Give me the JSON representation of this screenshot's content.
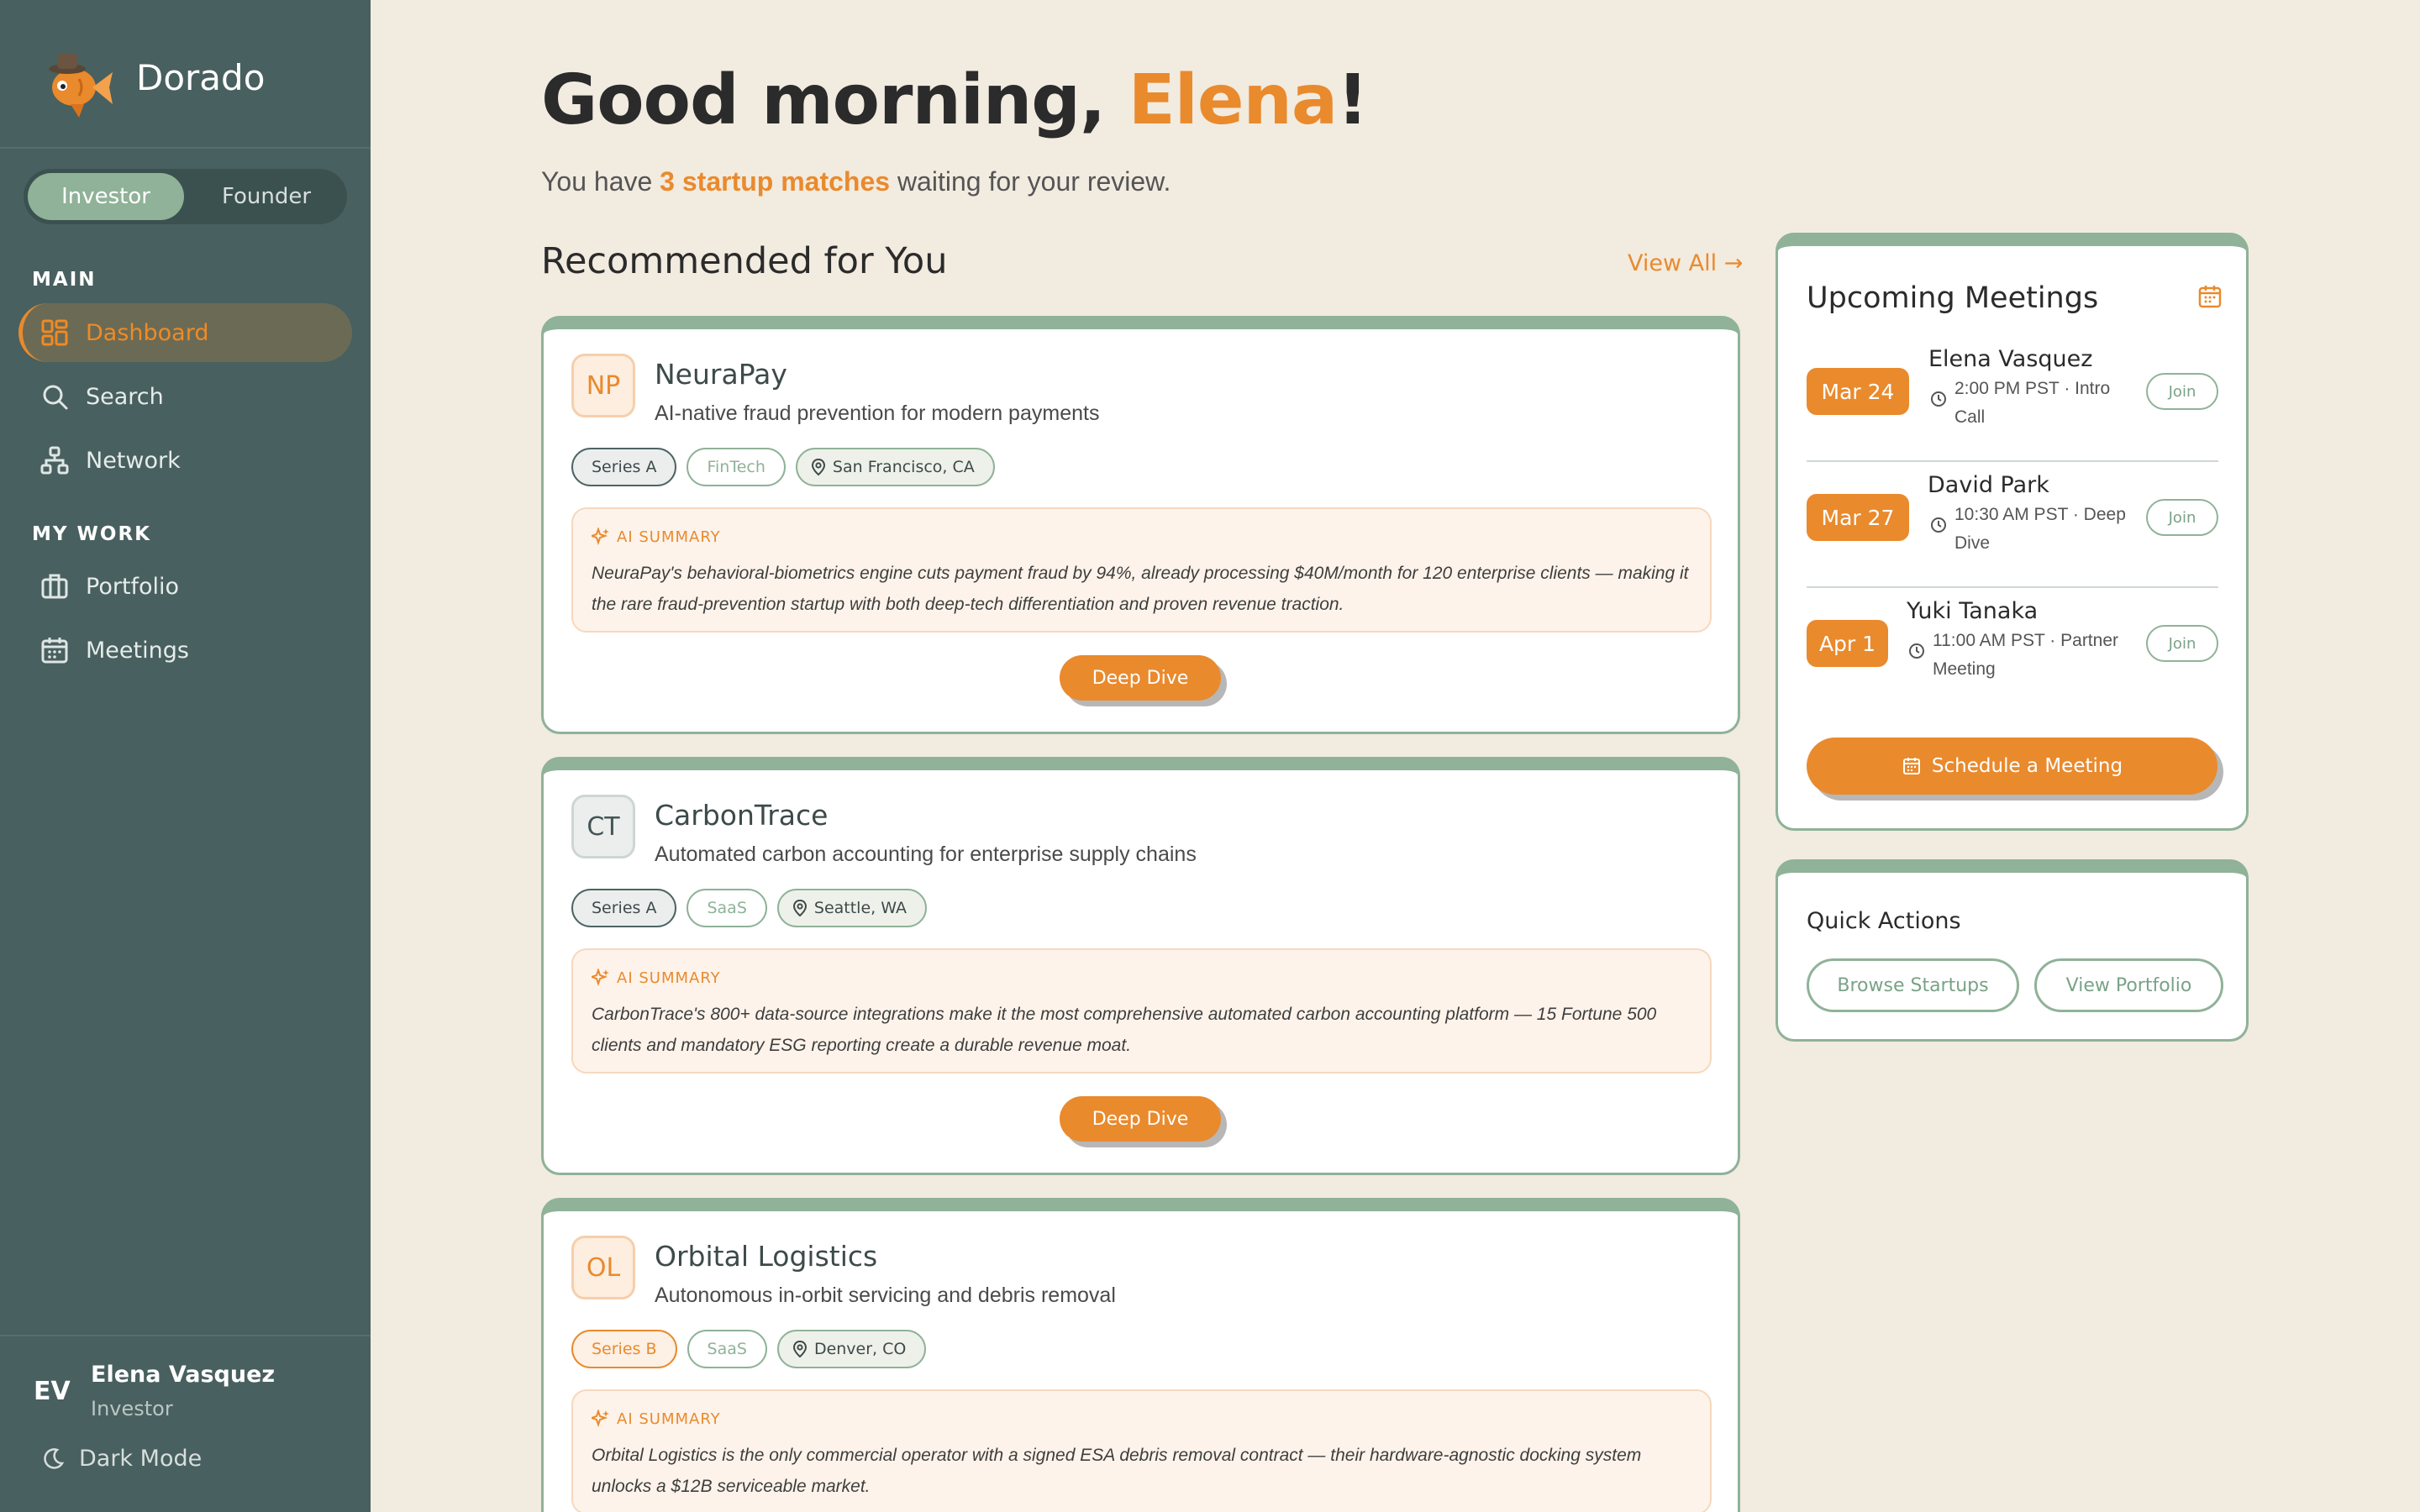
{
  "app": {
    "name": "Dorado"
  },
  "role_toggle": {
    "active": "Investor",
    "inactive": "Founder"
  },
  "nav": {
    "main_heading": "MAIN",
    "work_heading": "MY WORK",
    "items": [
      {
        "label": "Dashboard",
        "icon": "dashboard-grid-icon",
        "active": true
      },
      {
        "label": "Search",
        "icon": "search-icon"
      },
      {
        "label": "Network",
        "icon": "network-icon"
      },
      {
        "label": "Portfolio",
        "icon": "briefcase-icon"
      },
      {
        "label": "Meetings",
        "icon": "calendar-icon"
      }
    ]
  },
  "user": {
    "initials": "EV",
    "name": "Elena Vasquez",
    "role": "Investor",
    "dark_mode_label": "Dark Mode"
  },
  "greeting": {
    "prefix": "Good morning, ",
    "name": "Elena",
    "suffix": "!"
  },
  "subline": {
    "prefix": "You have ",
    "highlight": "3 startup matches",
    "suffix": " waiting for your review."
  },
  "recommended": {
    "title": "Recommended for You",
    "view_all": "View All →",
    "summary_label": "AI SUMMARY",
    "cta_label": "Deep Dive",
    "cards": [
      {
        "initials": "NP",
        "name": "NeuraPay",
        "tagline": "AI-native fraud prevention for modern payments",
        "stage": "Series A",
        "sector": "FinTech",
        "location": "San Francisco, CA",
        "summary": "NeuraPay's behavioral-biometrics engine cuts payment fraud by 94%, already processing $40M/month for 120 enterprise clients — making it the rare fraud-prevention startup with both deep-tech differentiation and proven revenue traction."
      },
      {
        "initials": "CT",
        "name": "CarbonTrace",
        "tagline": "Automated carbon accounting for enterprise supply chains",
        "stage": "Series A",
        "sector": "SaaS",
        "location": "Seattle, WA",
        "summary": "CarbonTrace's 800+ data-source integrations make it the most comprehensive automated carbon accounting platform — 15 Fortune 500 clients and mandatory ESG reporting create a durable revenue moat."
      },
      {
        "initials": "OL",
        "name": "Orbital Logistics",
        "tagline": "Autonomous in-orbit servicing and debris removal",
        "stage": "Series B",
        "sector": "SaaS",
        "location": "Denver, CO",
        "summary": "Orbital Logistics is the only commercial operator with a signed ESA debris removal contract — their hardware-agnostic docking system unlocks a $12B serviceable market."
      }
    ]
  },
  "meetings": {
    "title": "Upcoming Meetings",
    "join_label": "Join",
    "schedule_label": "Schedule a Meeting",
    "items": [
      {
        "date": "Mar 24",
        "name": "Elena Vasquez",
        "time_line1": "2:00 PM PST · Intro",
        "time_line2": "Call"
      },
      {
        "date": "Mar 27",
        "name": "David Park",
        "time_line1": "10:30 AM PST · Deep",
        "time_line2": "Dive"
      },
      {
        "date": "Apr 1",
        "name": "Yuki Tanaka",
        "time_line1": "11:00 AM PST · Partner",
        "time_line2": "Meeting"
      }
    ]
  },
  "quick_actions": {
    "title": "Quick Actions",
    "browse": "Browse Startups",
    "portfolio": "View Portfolio"
  },
  "colors": {
    "accent": "#e98a2d",
    "sage": "#8fb298",
    "sidebar": "#48605f",
    "background": "#f2ebe0"
  }
}
